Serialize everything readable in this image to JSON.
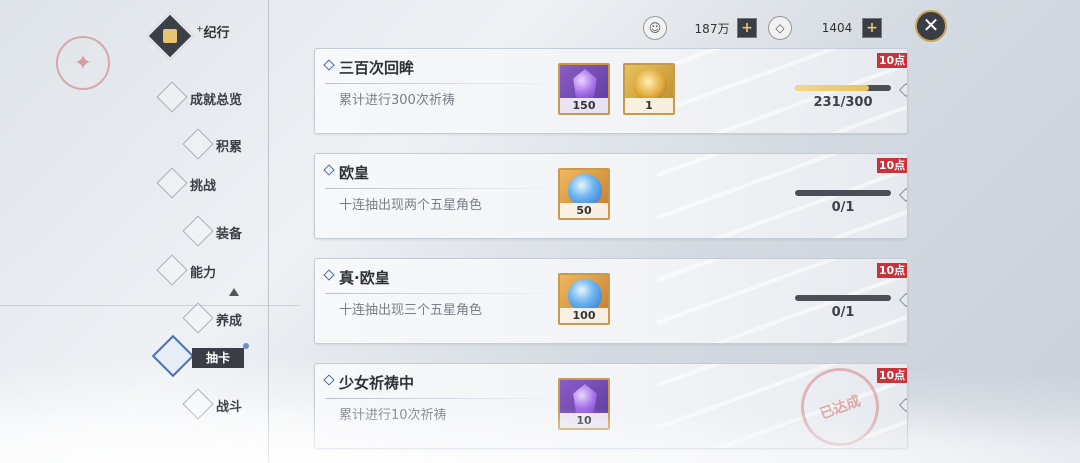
{
  "header": {
    "journal_title": "纪行",
    "resources": [
      {
        "icon": "emblem-icon",
        "value": "187万"
      },
      {
        "icon": "diamond-icon",
        "value": "1404"
      }
    ],
    "plus_label": "+",
    "close_label": "✕"
  },
  "sidebar": {
    "items": [
      {
        "label": "成就总览"
      },
      {
        "label": "积累"
      },
      {
        "label": "挑战"
      },
      {
        "label": "装备"
      },
      {
        "label": "能力"
      },
      {
        "label": "养成"
      },
      {
        "label": "抽卡",
        "active": true
      },
      {
        "label": "战斗"
      }
    ]
  },
  "achievements": [
    {
      "title": "三百次回眸",
      "desc": "累计进行300次祈祷",
      "badge": "10点",
      "rewards": [
        {
          "type": "purple",
          "icon": "purple-crystal-icon",
          "count": "150"
        },
        {
          "type": "gold",
          "icon": "gold-coin-icon",
          "count": "1"
        }
      ],
      "progress_current": 231,
      "progress_total": 300,
      "progress_text": "231/300",
      "completed": false
    },
    {
      "title": "欧皇",
      "desc": "十连抽出现两个五星角色",
      "badge": "10点",
      "rewards": [
        {
          "type": "orange",
          "icon": "blue-slime-icon",
          "count": "50"
        }
      ],
      "progress_current": 0,
      "progress_total": 1,
      "progress_text": "0/1",
      "completed": false
    },
    {
      "title": "真·欧皇",
      "desc": "十连抽出现三个五星角色",
      "badge": "10点",
      "rewards": [
        {
          "type": "orange",
          "icon": "blue-slime-icon",
          "count": "100"
        }
      ],
      "progress_current": 0,
      "progress_total": 1,
      "progress_text": "0/1",
      "completed": false
    },
    {
      "title": "少女祈祷中",
      "desc": "累计进行10次祈祷",
      "badge": "10点",
      "rewards": [
        {
          "type": "purple",
          "icon": "purple-crystal-icon",
          "count": "10"
        }
      ],
      "completed": true,
      "stamp_text": "已达成"
    }
  ],
  "colors": {
    "accent": "#c8323a",
    "dark": "#3a3d45",
    "progress_fill": "#e8c15c"
  }
}
